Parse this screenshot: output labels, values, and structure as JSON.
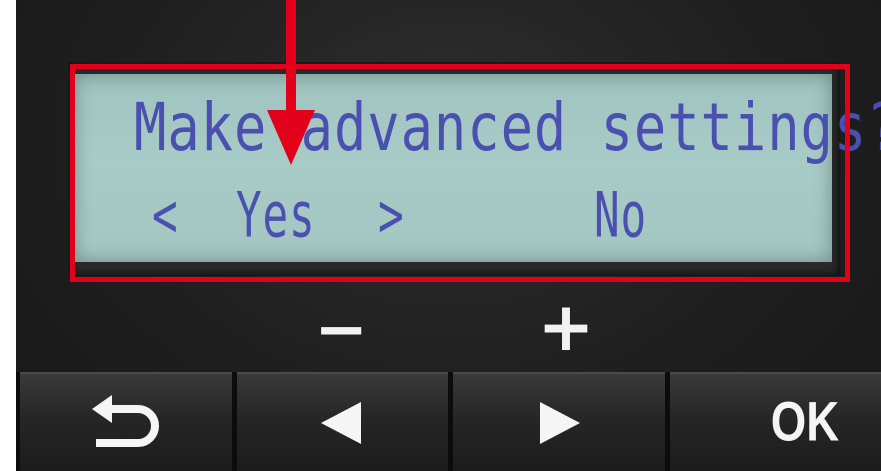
{
  "lcd": {
    "prompt": "Make advanced settings?",
    "left_arrow": "<",
    "option_selected": "Yes",
    "right_arrow": ">",
    "option_other": "No",
    "text_color": "#4a4fb0",
    "backlight_color": "#a6c8c4"
  },
  "labels": {
    "minus": "−",
    "plus": "+"
  },
  "buttons": {
    "back_icon": "back-return-icon",
    "left_icon": "triangle-left-icon",
    "right_icon": "triangle-right-icon",
    "ok_label": "OK"
  },
  "annotation": {
    "highlight_color": "#e3001a",
    "arrow_icon": "arrow-down-icon"
  }
}
